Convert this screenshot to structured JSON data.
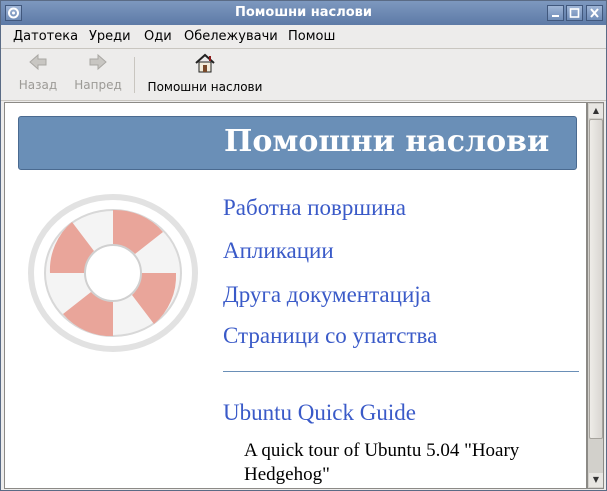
{
  "window": {
    "title": "Помошни наслови"
  },
  "menubar": {
    "items": [
      {
        "label": "Датотека"
      },
      {
        "label": "Уреди"
      },
      {
        "label": "Оди"
      },
      {
        "label": "Обележувачи"
      },
      {
        "label": "Помош"
      }
    ]
  },
  "toolbar": {
    "back_label": "Назад",
    "forward_label": "Напред",
    "home_label": "Помошни наслови"
  },
  "page": {
    "heading": "Помошни наслови",
    "links": [
      {
        "label": "Работна површина"
      },
      {
        "label": "Апликации"
      },
      {
        "label": "Друга документација"
      },
      {
        "label": "Страници со упатства"
      }
    ],
    "guide_link": "Ubuntu Quick Guide",
    "guide_desc": "A quick tour of Ubuntu 5.04 \"Hoary Hedgehog\""
  },
  "colors": {
    "titlebar": "#6d89b2",
    "header_box": "#6a8fb7",
    "link": "#3a5ac8"
  },
  "icons": {
    "window_menu": "window-menu-icon",
    "back": "back-arrow-icon",
    "forward": "forward-arrow-icon",
    "home": "home-icon",
    "logo": "lifebuoy-icon"
  }
}
